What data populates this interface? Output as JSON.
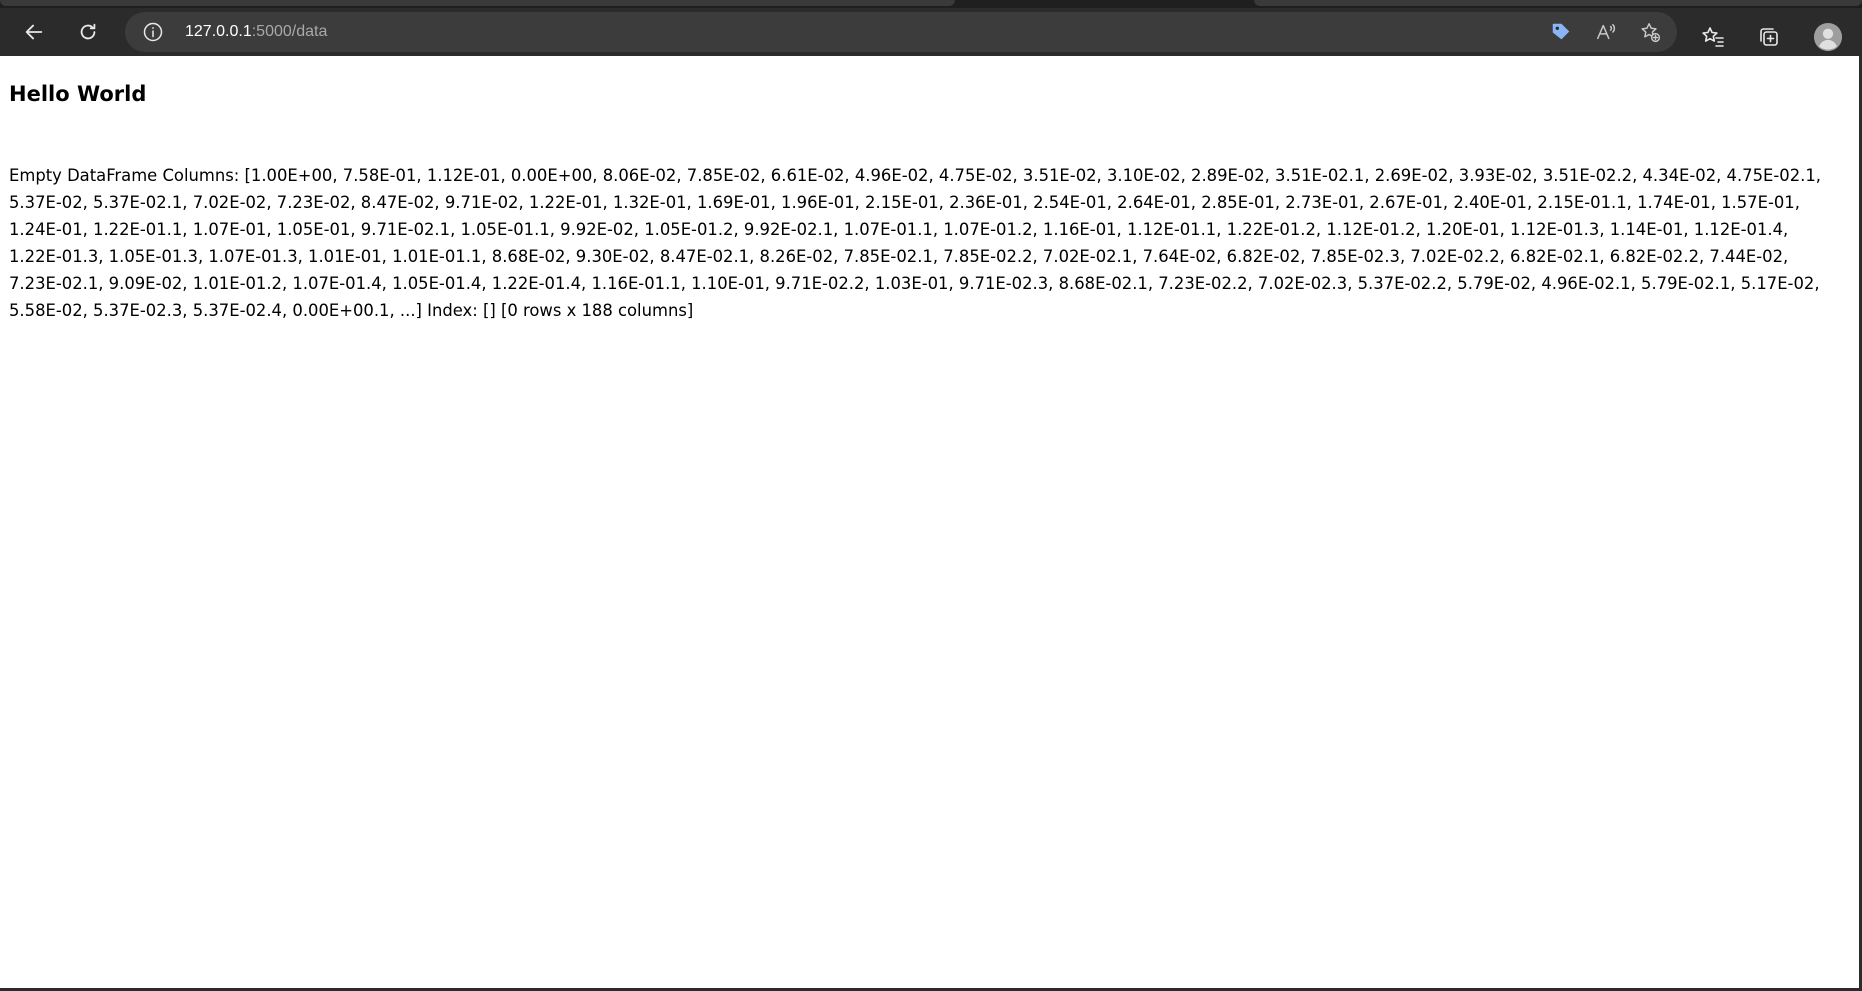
{
  "browser": {
    "url_host": "127.0.0.1",
    "url_path": ":5000/data",
    "icons": {
      "back": "back-arrow-icon",
      "refresh": "refresh-icon",
      "info": "info-icon",
      "tag": "shopping-tag-icon",
      "read_aloud": "read-aloud-icon",
      "add_favorite": "add-favorite-icon",
      "favorites": "favorites-icon",
      "collections": "collections-icon",
      "profile": "profile-avatar-icon"
    },
    "colors": {
      "chrome_bg": "#2b2b2b",
      "omnibox_bg": "#3c3c3c",
      "tag_icon": "#8ab4f8"
    }
  },
  "page": {
    "heading": "Hello World",
    "body_text": "Empty DataFrame Columns: [1.00E+00, 7.58E-01, 1.12E-01, 0.00E+00, 8.06E-02, 7.85E-02, 6.61E-02, 4.96E-02, 4.75E-02, 3.51E-02, 3.10E-02, 2.89E-02, 3.51E-02.1, 2.69E-02, 3.93E-02, 3.51E-02.2, 4.34E-02, 4.75E-02.1, 5.37E-02, 5.37E-02.1, 7.02E-02, 7.23E-02, 8.47E-02, 9.71E-02, 1.22E-01, 1.32E-01, 1.69E-01, 1.96E-01, 2.15E-01, 2.36E-01, 2.54E-01, 2.64E-01, 2.85E-01, 2.73E-01, 2.67E-01, 2.40E-01, 2.15E-01.1, 1.74E-01, 1.57E-01, 1.24E-01, 1.22E-01.1, 1.07E-01, 1.05E-01, 9.71E-02.1, 1.05E-01.1, 9.92E-02, 1.05E-01.2, 9.92E-02.1, 1.07E-01.1, 1.07E-01.2, 1.16E-01, 1.12E-01.1, 1.22E-01.2, 1.12E-01.2, 1.20E-01, 1.12E-01.3, 1.14E-01, 1.12E-01.4, 1.22E-01.3, 1.05E-01.3, 1.07E-01.3, 1.01E-01, 1.01E-01.1, 8.68E-02, 9.30E-02, 8.47E-02.1, 8.26E-02, 7.85E-02.1, 7.85E-02.2, 7.02E-02.1, 7.64E-02, 6.82E-02, 7.85E-02.3, 7.02E-02.2, 6.82E-02.1, 6.82E-02.2, 7.44E-02, 7.23E-02.1, 9.09E-02, 1.01E-01.2, 1.07E-01.4, 1.05E-01.4, 1.22E-01.4, 1.16E-01.1, 1.10E-01, 9.71E-02.2, 1.03E-01, 9.71E-02.3, 8.68E-02.1, 7.23E-02.2, 7.02E-02.3, 5.37E-02.2, 5.79E-02, 4.96E-02.1, 5.79E-02.1, 5.17E-02, 5.58E-02, 5.37E-02.3, 5.37E-02.4, 0.00E+00.1, ...] Index: [] [0 rows x 188 columns]"
  }
}
